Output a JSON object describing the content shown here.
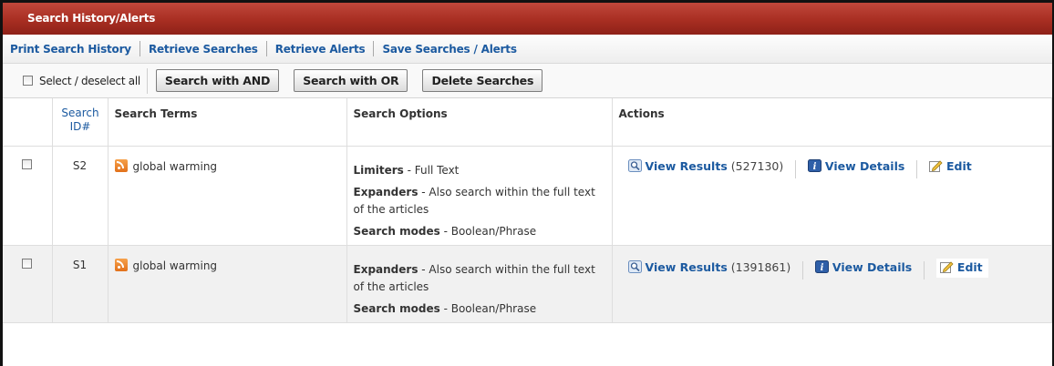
{
  "panel": {
    "title": "Search History/Alerts"
  },
  "links": [
    "Print Search History",
    "Retrieve Searches",
    "Retrieve Alerts",
    "Save Searches / Alerts"
  ],
  "toolbar": {
    "select_label": "Select / deselect all",
    "and_label": "Search with AND",
    "or_label": "Search with OR",
    "delete_label": "Delete Searches"
  },
  "table": {
    "headers": {
      "id_line1": "Search",
      "id_line2": "ID#",
      "terms": "Search Terms",
      "options": "Search Options",
      "actions": "Actions"
    },
    "rows": [
      {
        "id": "S2",
        "term": "global warming",
        "options": [
          {
            "label": "Limiters",
            "text": " - Full Text"
          },
          {
            "label": "Expanders",
            "text": " - Also search within the full text of the articles"
          },
          {
            "label": "Search modes",
            "text": " - Boolean/Phrase"
          }
        ],
        "view_results": "View Results",
        "count": "(527130)",
        "view_details": "View Details",
        "edit": "Edit"
      },
      {
        "id": "S1",
        "term": "global warming",
        "options": [
          {
            "label": "Expanders",
            "text": " - Also search within the full text of the articles"
          },
          {
            "label": "Search modes",
            "text": " - Boolean/Phrase"
          }
        ],
        "view_results": "View Results",
        "count": "(1391861)",
        "view_details": "View Details",
        "edit": "Edit"
      }
    ]
  },
  "icons": [
    "rss-icon",
    "magnifier-icon",
    "info-icon",
    "edit-icon"
  ],
  "colors": {
    "title_bar": "#a82e22",
    "link": "#1c5aa0",
    "rss": "#e8791f"
  }
}
